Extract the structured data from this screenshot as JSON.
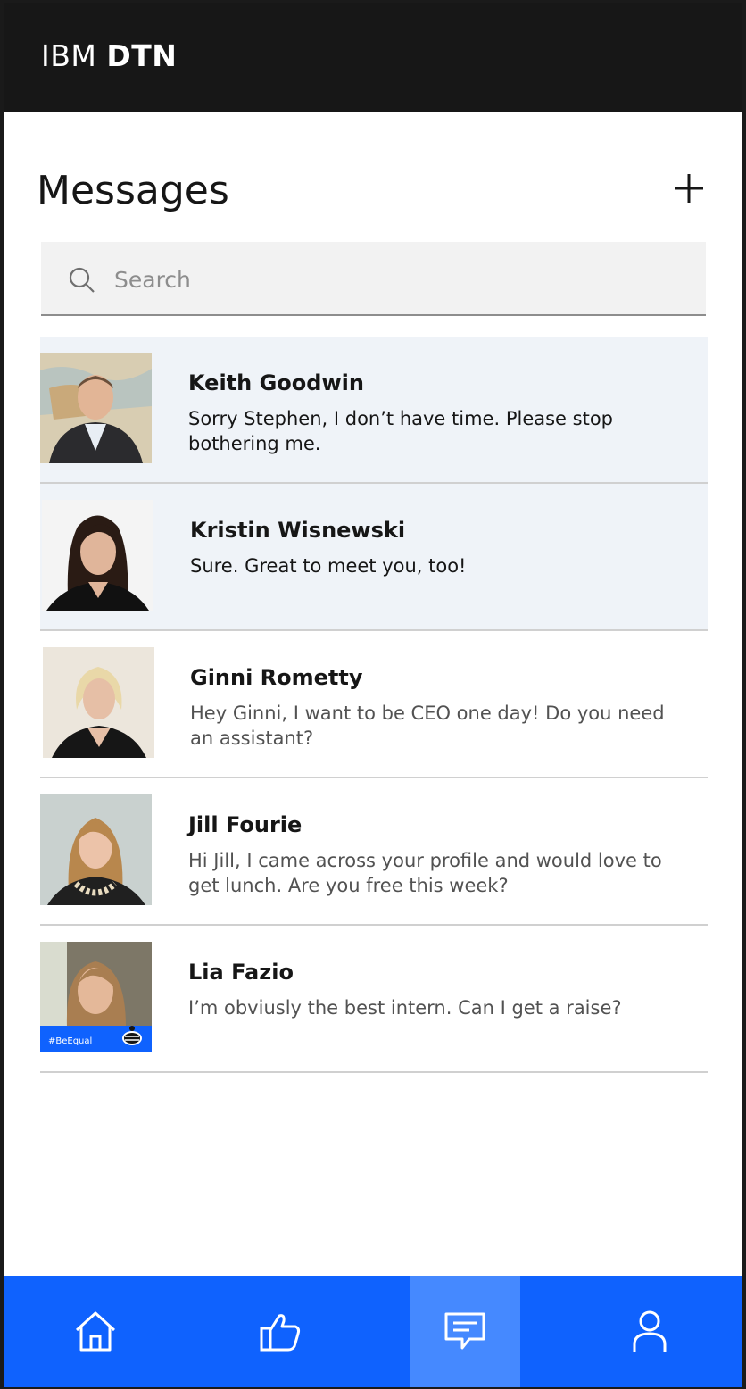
{
  "header": {
    "brand_light": "IBM",
    "brand_bold": "DTN"
  },
  "page": {
    "title": "Messages",
    "add_icon": "plus-icon"
  },
  "search": {
    "placeholder": "Search",
    "value": "",
    "icon": "search-icon"
  },
  "conversations": [
    {
      "name": "Keith Goodwin",
      "snippet": "Sorry Stephen, I don’t have time. Please stop bothering me.",
      "unread": true
    },
    {
      "name": "Kristin Wisnewski",
      "snippet": "Sure. Great to meet you, too!",
      "unread": true
    },
    {
      "name": "Ginni Rometty",
      "snippet": "Hey Ginni, I want to be CEO one day! Do you need an assistant?",
      "unread": false
    },
    {
      "name": "Jill Fourie",
      "snippet": "Hi Jill, I came across your profile and would love to get lunch. Are you free this week?",
      "unread": false
    },
    {
      "name": "Lia Fazio",
      "snippet": "I’m obviusly the best intern. Can I get a raise?",
      "unread": false,
      "badge": "#BeEqual"
    }
  ],
  "tabbar": {
    "tabs": [
      {
        "icon": "home-icon",
        "active": false
      },
      {
        "icon": "thumbs-up-icon",
        "active": false
      },
      {
        "icon": "chat-icon",
        "active": true
      },
      {
        "icon": "user-icon",
        "active": false
      }
    ]
  },
  "colors": {
    "accent": "#0f62fe",
    "accent_active": "#4589ff",
    "header_bg": "#171717",
    "unread_bg": "#eff3f8"
  }
}
